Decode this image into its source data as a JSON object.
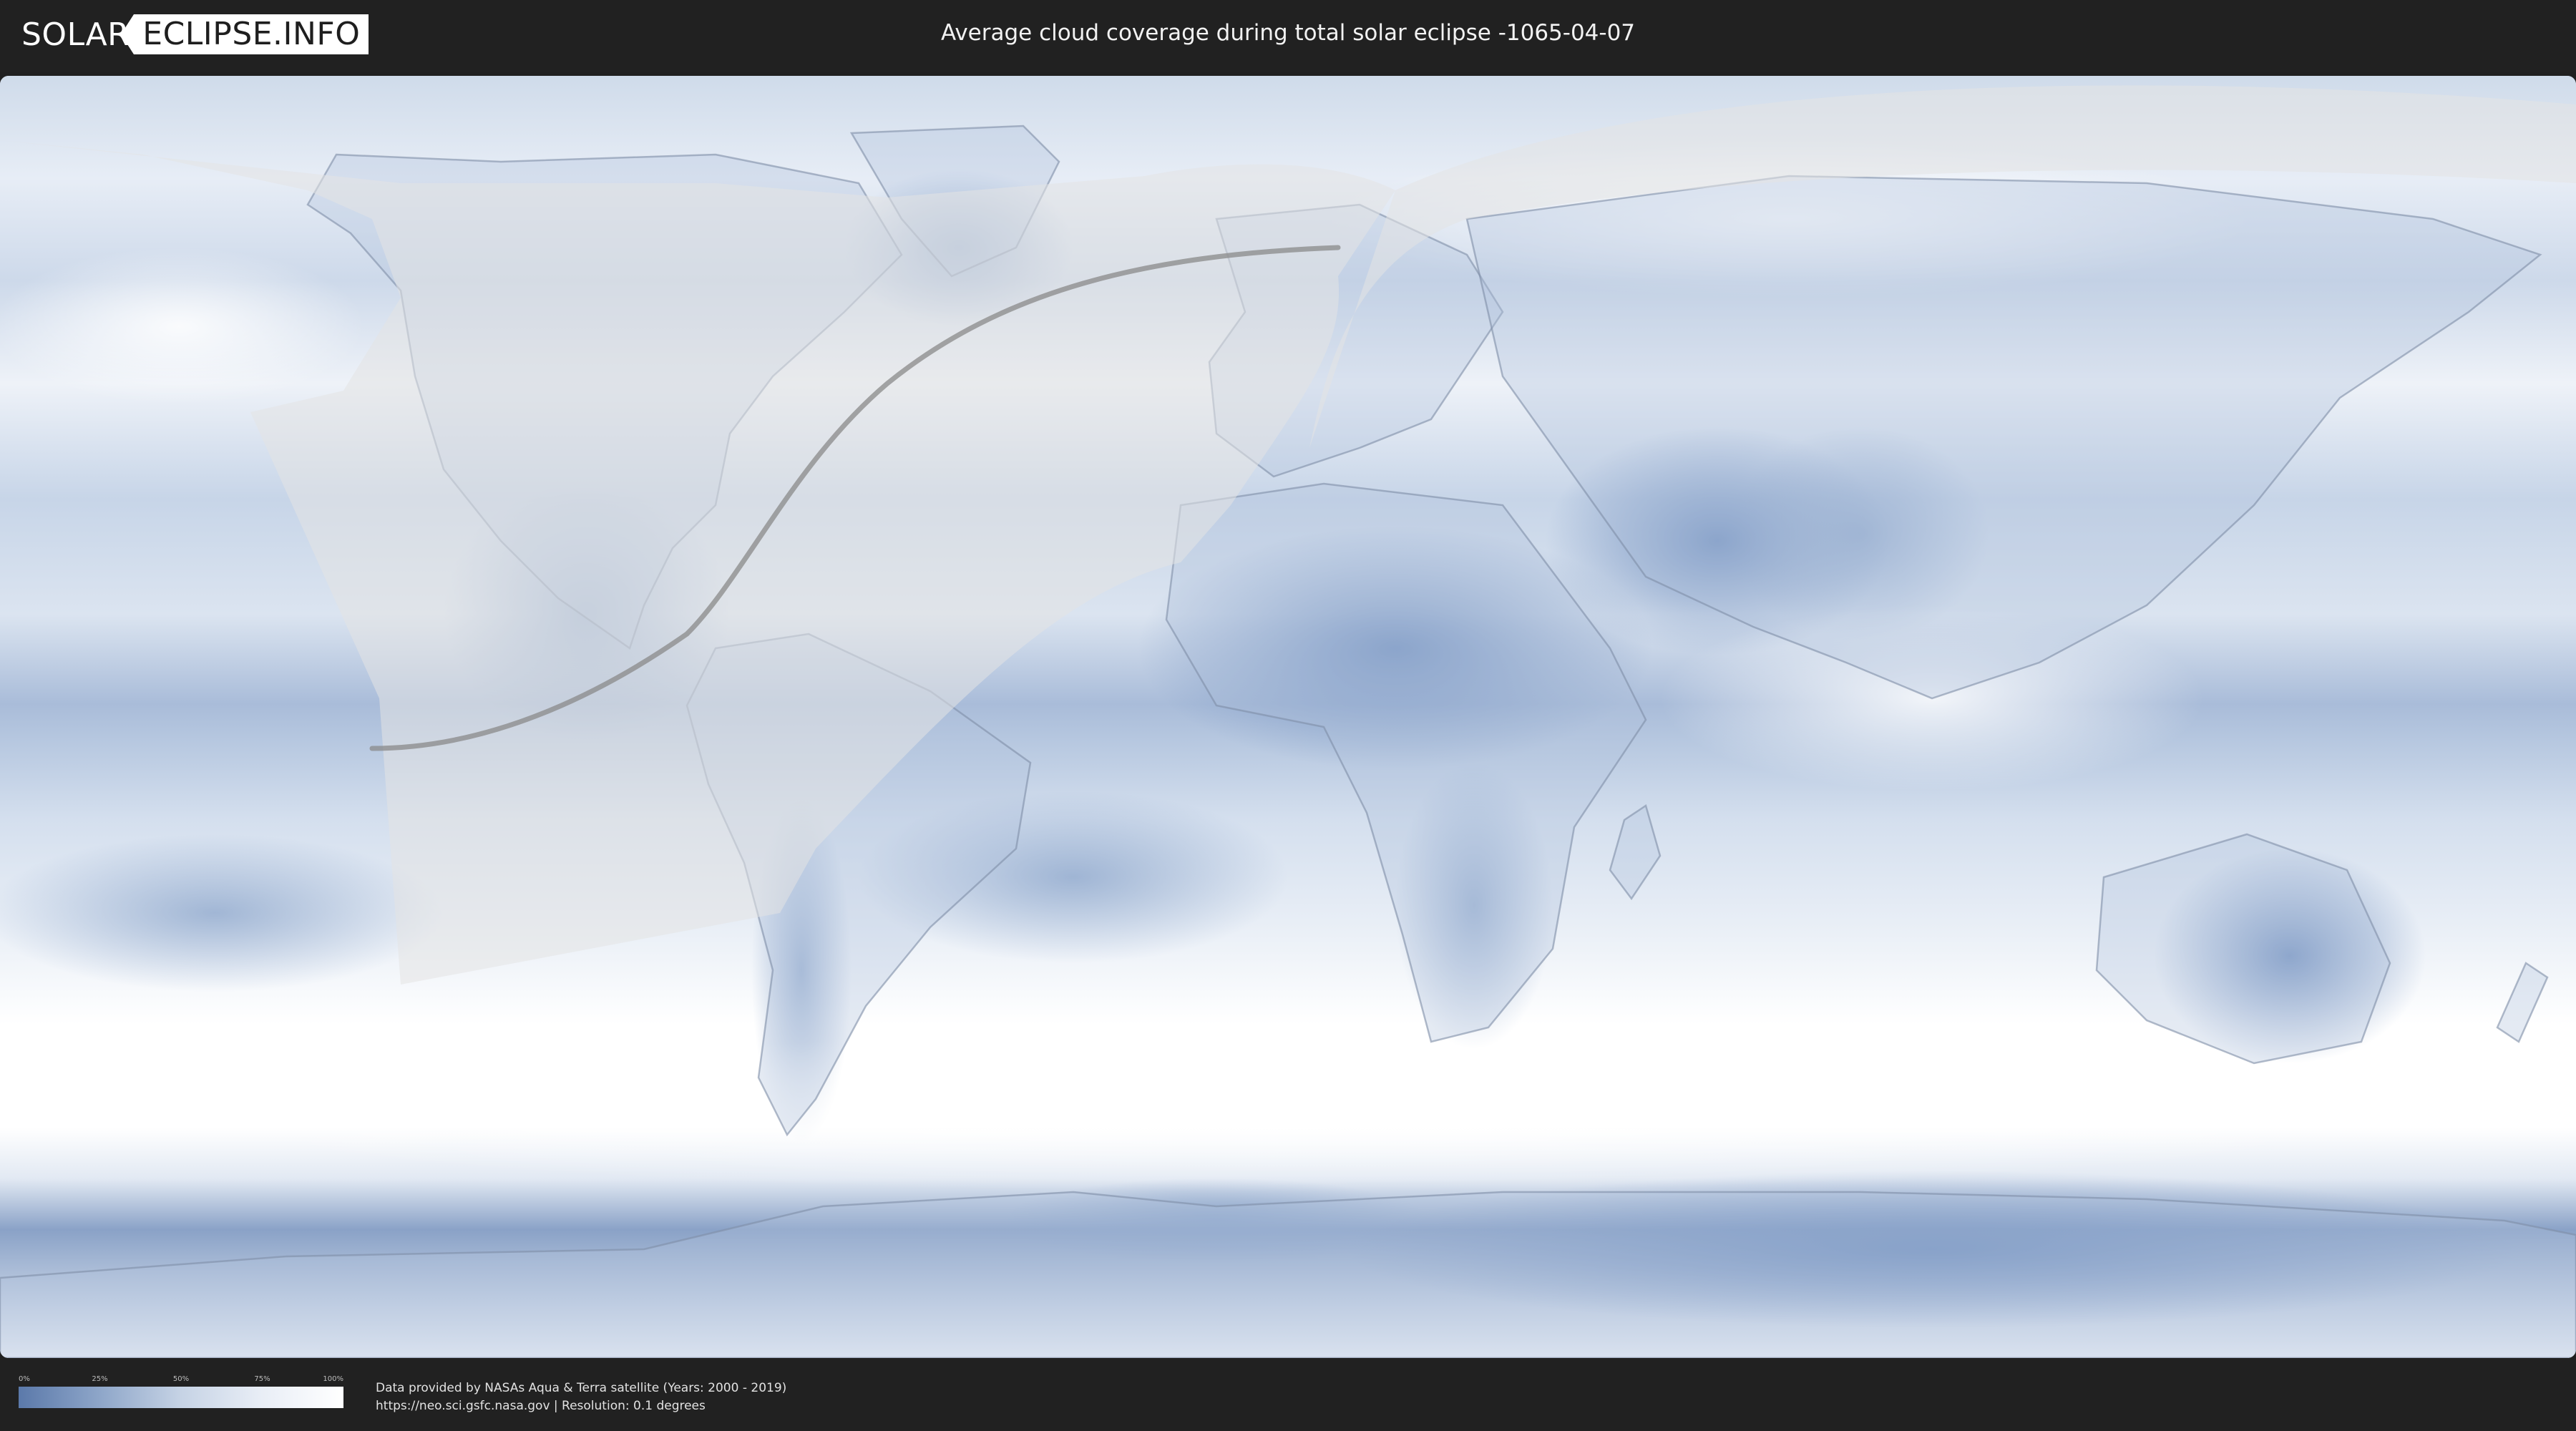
{
  "header": {
    "logo_left": "SOLAR",
    "logo_right": "ECLIPSE.INFO",
    "title": "Average cloud coverage during total solar eclipse -1065-04-07"
  },
  "legend": {
    "ticks": [
      "0%",
      "25%",
      "50%",
      "75%",
      "100%"
    ],
    "colors": [
      "#5b79aa",
      "#8ea6c9",
      "#c6d3e5",
      "#e9eef6",
      "#ffffff"
    ]
  },
  "footer": {
    "credit_line": "Data provided by NASAs Aqua & Terra satellite (Years: 2000 - 2019)",
    "source_line": "https://neo.sci.gsfc.nasa.gov | Resolution: 0.1 degrees"
  },
  "map": {
    "projection": "equirectangular",
    "colors": {
      "clear_sky": "#6d8bbb",
      "cloudy": "#ffffff",
      "eclipse_overlay": "#e4e4e4",
      "totality_path": "#8a8a8a"
    }
  }
}
